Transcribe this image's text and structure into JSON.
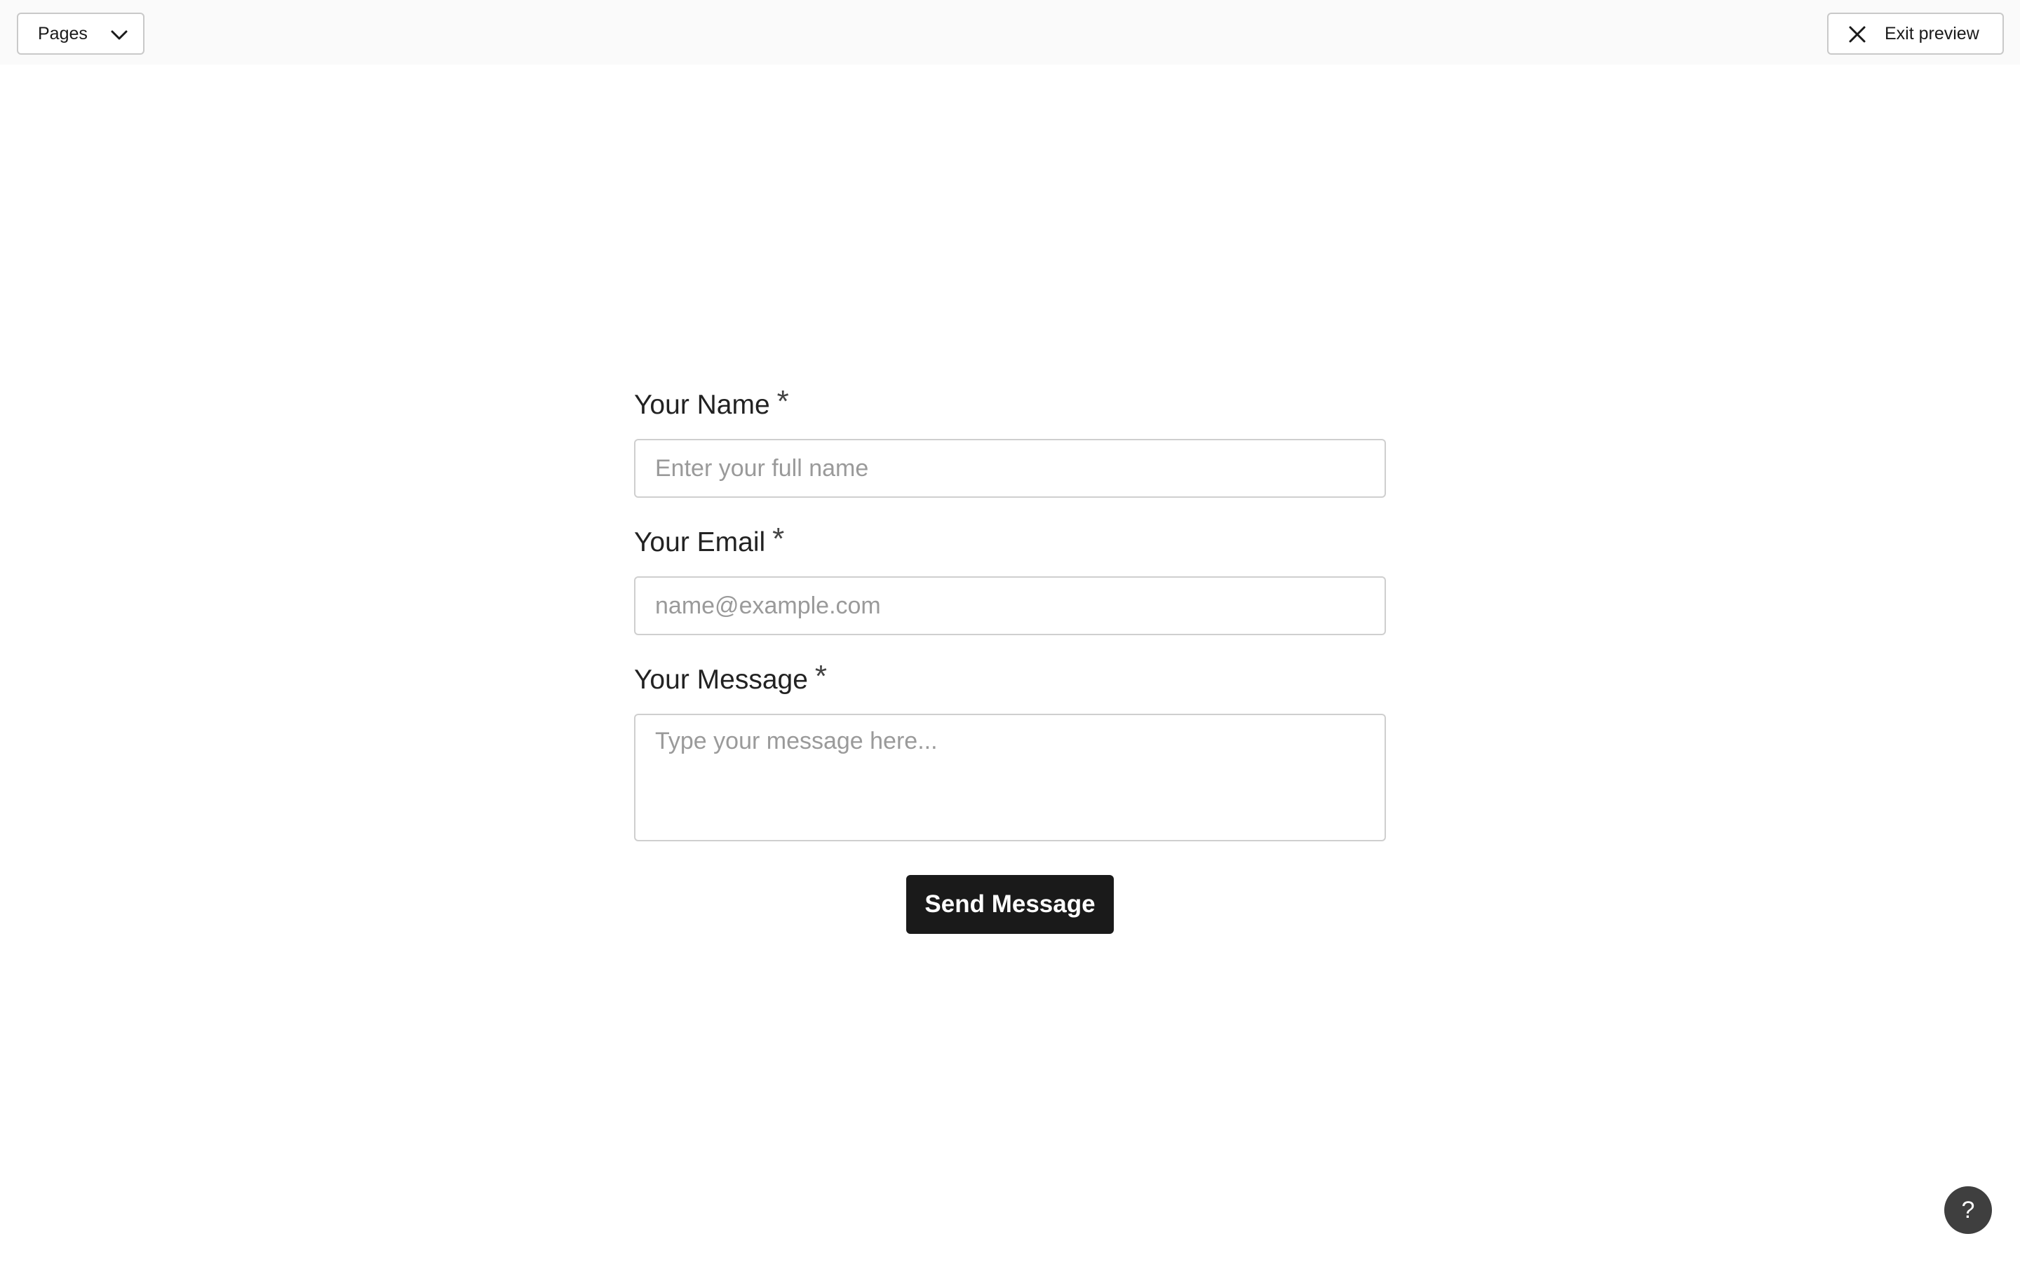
{
  "toolbar": {
    "pages_label": "Pages",
    "exit_label": "Exit preview"
  },
  "form": {
    "name": {
      "label": "Your Name",
      "required_mark": "*",
      "placeholder": "Enter your full name"
    },
    "email": {
      "label": "Your Email",
      "required_mark": "*",
      "placeholder": "name@example.com"
    },
    "message": {
      "label": "Your Message",
      "required_mark": "*",
      "placeholder": "Type your message here..."
    },
    "submit_label": "Send Message"
  },
  "help": {
    "label": "?"
  },
  "icons": {
    "pages_dropdown": "chevron-down-icon",
    "exit": "close-icon"
  },
  "colors": {
    "primary_button": "#1a1a1a",
    "help_button": "#3f3f3f"
  }
}
